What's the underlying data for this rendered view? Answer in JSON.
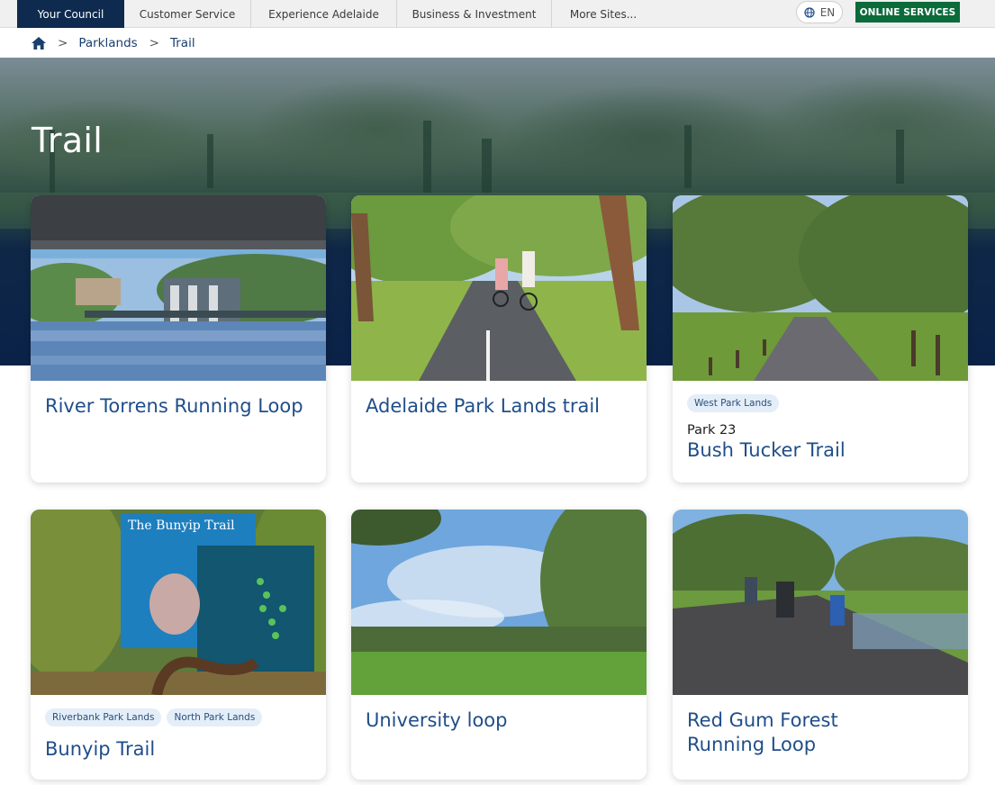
{
  "topnav": {
    "tabs": [
      "Your Council",
      "Customer Service",
      "Experience Adelaide",
      "Business & Investment",
      "More Sites..."
    ],
    "language": "EN",
    "online_services": "ONLINE SERVICES"
  },
  "breadcrumb": {
    "items": [
      "Parklands",
      "Trail"
    ],
    "sep": ">"
  },
  "hero": {
    "title": "Trail"
  },
  "cards": [
    {
      "title": "River Torrens Running Loop",
      "tags": [],
      "subtitle": ""
    },
    {
      "title": "Adelaide Park Lands trail",
      "tags": [],
      "subtitle": ""
    },
    {
      "title": "Bush Tucker Trail",
      "tags": [
        "West Park Lands"
      ],
      "subtitle": "Park 23"
    },
    {
      "title": "Bunyip Trail",
      "tags": [
        "Riverbank Park Lands",
        "North Park Lands"
      ],
      "subtitle": ""
    },
    {
      "title": "University loop",
      "tags": [],
      "subtitle": ""
    },
    {
      "title": "Red Gum Forest Running Loop",
      "tags": [],
      "subtitle": ""
    }
  ],
  "bunyip_sign": {
    "heading": "The Bunyip Trail"
  },
  "colors": {
    "nav_active": "#0e2a4f",
    "online_services": "#0b6b3a",
    "title_blue": "#1f4e8a",
    "tag_bg": "#e3eef8",
    "hero_dark": "#0a2247"
  },
  "icons": {
    "home": "home-icon",
    "globe": "globe-icon"
  }
}
